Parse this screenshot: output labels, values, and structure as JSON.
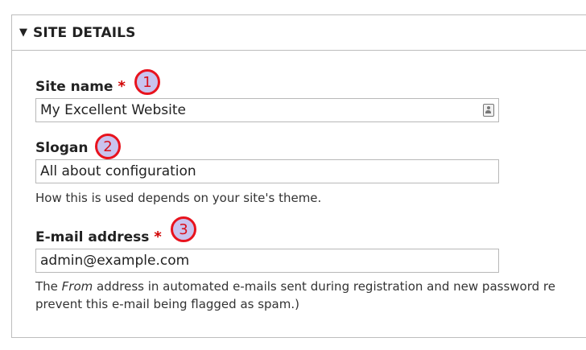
{
  "fieldset": {
    "title": "SITE DETAILS",
    "toggle_symbol": "▼",
    "expanded": true
  },
  "fields": {
    "site_name": {
      "label": "Site name",
      "required_marker": "*",
      "value": "My Excellent Website",
      "icon": "contact-card-icon"
    },
    "slogan": {
      "label": "Slogan",
      "value": "All about configuration",
      "description": "How this is used depends on your site's theme."
    },
    "email": {
      "label": "E-mail address",
      "required_marker": "*",
      "value": "admin@example.com",
      "description_line1_before": "The ",
      "description_line1_em": "From",
      "description_line1_after": " address in automated e-mails sent during registration and new password re",
      "description_line2": "prevent this e-mail being flagged as spam.)"
    }
  },
  "callouts": [
    "1",
    "2",
    "3"
  ],
  "colors": {
    "required": "#d10000",
    "callout_fill": "#c9c3ee",
    "callout_border": "#e8131e",
    "border": "#bdbdbd"
  }
}
